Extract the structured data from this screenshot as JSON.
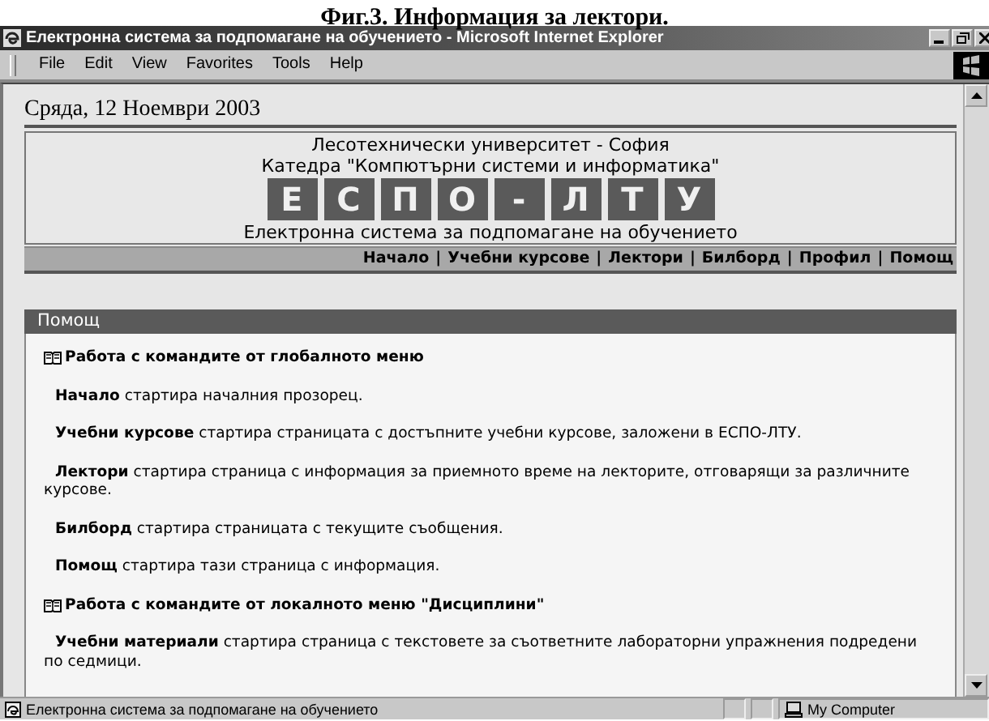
{
  "caption": "Фиг.3. Информация за лектори.",
  "window": {
    "title": "Електронна система за подпомагане на обучението - Microsoft Internet Explorer"
  },
  "menu": [
    "File",
    "Edit",
    "View",
    "Favorites",
    "Tools",
    "Help"
  ],
  "page": {
    "date": "Сряда, 12 Ноември 2003",
    "header": {
      "lines": [
        "Лесотехнически университет - София",
        "Катедра \"Компютърни системи и информатика\""
      ],
      "logo": [
        "Е",
        "С",
        "П",
        "О",
        "-",
        "Л",
        "Т",
        "У"
      ],
      "subtitle": "Електронна система за подпомагане на обучението"
    },
    "nav": {
      "separator": "|",
      "items": [
        "Начало",
        "Учебни курсове",
        "Лектори",
        "Билборд",
        "Профил",
        "Помощ"
      ]
    },
    "help": {
      "title": "Помощ",
      "blocks": [
        {
          "kind": "heading",
          "text": "Работа с командите от глобалното меню"
        },
        {
          "kind": "entry",
          "text": "**Начало** стартира началния прозорец."
        },
        {
          "kind": "entry",
          "text": "**Учебни курсове** стартира страницата с достъпните учебни курсове, заложени в ЕСПО-ЛТУ."
        },
        {
          "kind": "entry",
          "text": "**Лектори** стартира страница с информация за приемното време на лекторите, отговарящи за различните курсове."
        },
        {
          "kind": "entry",
          "text": "**Билборд** стартира страницата с текущите съобщения."
        },
        {
          "kind": "entry",
          "text": "**Помощ** стартира тази страница с информация."
        },
        {
          "kind": "heading",
          "text": "Работа с командите от локалното меню \"Дисциплини\""
        },
        {
          "kind": "entry",
          "text": "**Учебни материали** стартира страница с текстовете за съответните лабораторни упражнения подредени по седмици."
        }
      ]
    }
  },
  "status_bar": {
    "text": "Електронна система за подпомагане на обучението",
    "zone": "My Computer"
  }
}
